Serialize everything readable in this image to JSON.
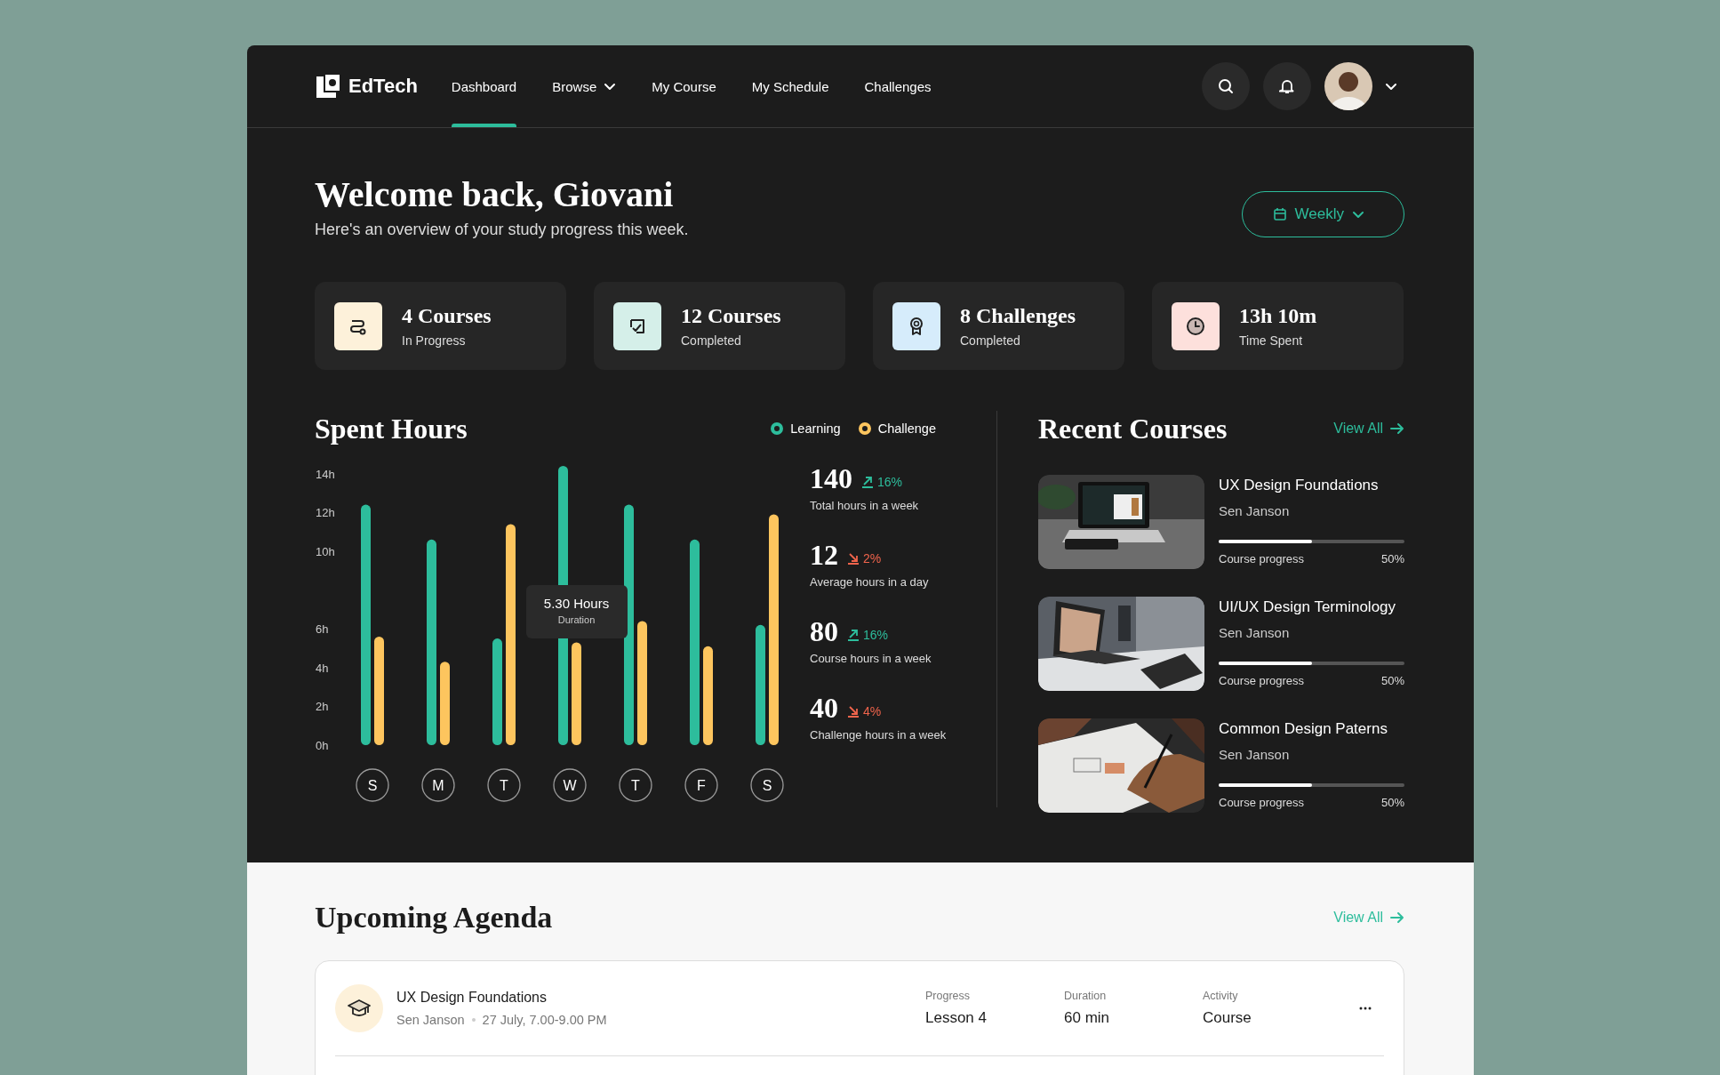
{
  "nav": {
    "logo": "EdTech",
    "items": [
      {
        "label": "Dashboard",
        "selected": true,
        "dropdown": false
      },
      {
        "label": "Browse",
        "selected": false,
        "dropdown": true
      },
      {
        "label": "My Course",
        "selected": false,
        "dropdown": false
      },
      {
        "label": "My Schedule",
        "selected": false,
        "dropdown": false
      },
      {
        "label": "Challenges",
        "selected": false,
        "dropdown": false
      }
    ]
  },
  "header": {
    "title": "Welcome back, Giovani",
    "subtitle": "Here's an overview of your study progress this week.",
    "period": "Weekly"
  },
  "stats": [
    {
      "value": "4 Courses",
      "label": "In Progress",
      "kind": "route",
      "color": "#fdf1da"
    },
    {
      "value": "12 Courses",
      "label": "Completed",
      "kind": "check",
      "color": "#d5efe9"
    },
    {
      "value": "8 Challenges",
      "label": "Completed",
      "kind": "award",
      "color": "#d6ecfb"
    },
    {
      "value": "13h 10m",
      "label": "Time Spent",
      "kind": "clock",
      "color": "#fde0dc"
    }
  ],
  "spent_hours": {
    "title": "Spent Hours",
    "chart_data": {
      "type": "bar",
      "categories": [
        "S",
        "M",
        "T",
        "W",
        "T",
        "F",
        "S"
      ],
      "series": [
        {
          "name": "Learning",
          "color": "#2dbd9c",
          "values": [
            12.4,
            10.6,
            5.5,
            14.4,
            12.4,
            10.6,
            6.2
          ]
        },
        {
          "name": "Challenge",
          "color": "#fdc55e",
          "values": [
            5.6,
            4.3,
            11.4,
            5.3,
            6.4,
            5.1,
            11.9
          ]
        }
      ],
      "ylim": [
        0,
        14.4
      ],
      "yticks": [
        {
          "value": 0,
          "label": "0h"
        },
        {
          "value": 2,
          "label": "2h"
        },
        {
          "value": 4,
          "label": "4h"
        },
        {
          "value": 6,
          "label": "6h"
        },
        {
          "value": 10,
          "label": "10h"
        },
        {
          "value": 12,
          "label": "12h"
        },
        {
          "value": 14,
          "label": "14h"
        }
      ]
    },
    "tooltip": {
      "value": "5.30 Hours",
      "label": "Duration"
    },
    "summary": [
      {
        "value": "140",
        "change": "16%",
        "increase": true,
        "label": "Total hours in a week"
      },
      {
        "value": "12",
        "change": "2%",
        "increase": false,
        "label": "Average hours in a day"
      },
      {
        "value": "80",
        "change": "16%",
        "increase": true,
        "label": "Course hours in a week"
      },
      {
        "value": "40",
        "change": "4%",
        "increase": false,
        "label": "Challenge hours in a week"
      }
    ]
  },
  "recent_courses": {
    "title": "Recent Courses",
    "view_all": "View All",
    "items": [
      {
        "title": "UX Design Foundations",
        "author": "Sen Janson",
        "progress_label": "Course progress",
        "progress": "50%",
        "level": 0.5,
        "kind": "picture"
      },
      {
        "title": "UI/UX Design Terminology",
        "author": "Sen Janson",
        "progress_label": "Course progress",
        "progress": "50%",
        "level": 0.5,
        "kind": "picture"
      },
      {
        "title": "Common Design Paterns",
        "author": "Sen Janson",
        "progress_label": "Course progress",
        "progress": "50%",
        "level": 0.5,
        "kind": "picture"
      }
    ]
  },
  "agenda": {
    "title": "Upcoming Agenda",
    "view_all": "View All",
    "items": [
      {
        "title": "UX Design Foundations",
        "author": "Sen Janson",
        "time": "27 July, 7.00-9.00 PM",
        "columns": [
          {
            "label": "Progress",
            "value": "Lesson 4"
          },
          {
            "label": "Duration",
            "value": "60 min"
          },
          {
            "label": "Activity",
            "value": "Course"
          }
        ]
      }
    ]
  }
}
